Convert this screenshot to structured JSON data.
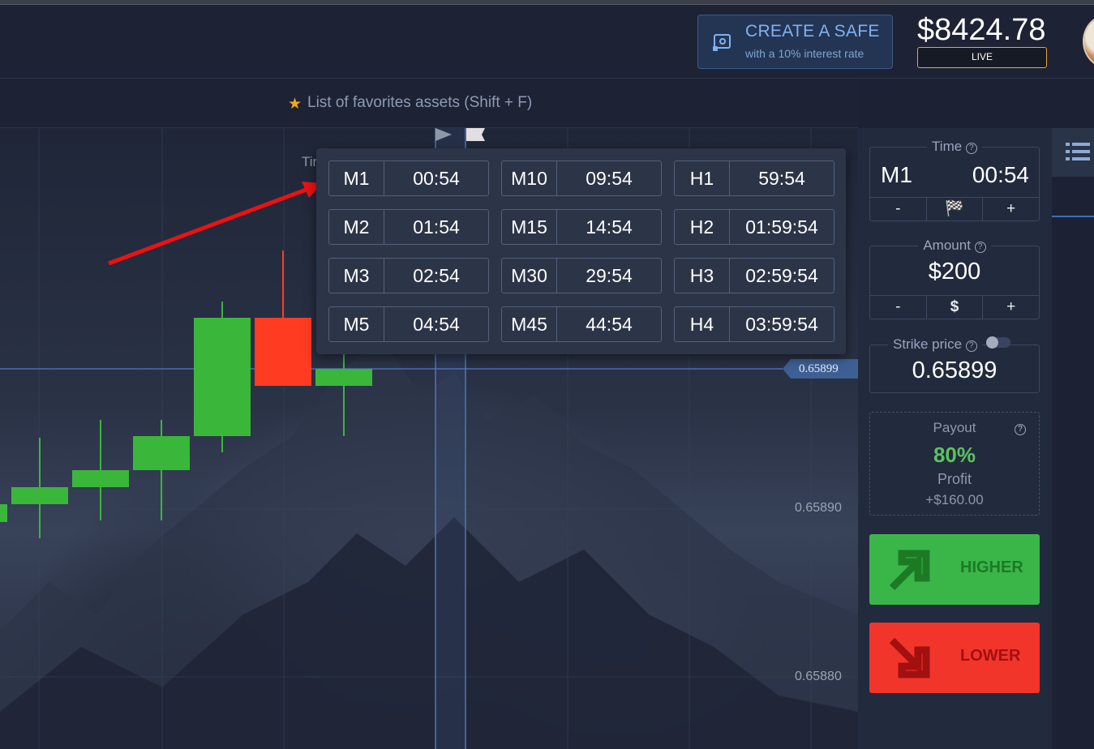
{
  "header": {
    "safe_button": {
      "title": "CREATE A SAFE",
      "subtitle": "with a 10% interest rate"
    },
    "balance": "$8424.78",
    "account_mode": "LIVE"
  },
  "favorites_bar": {
    "label": "List of favorites assets (Shift + F)"
  },
  "chart": {
    "price_levels": [
      "0.65899",
      "0.65890",
      "0.65880"
    ],
    "current_price_tag": "0.65899",
    "partial_label": "Tir"
  },
  "expiration_dropdown": {
    "options": [
      [
        {
          "code": "M1",
          "time": "00:54"
        },
        {
          "code": "M10",
          "time": "09:54"
        },
        {
          "code": "H1",
          "time": "59:54"
        }
      ],
      [
        {
          "code": "M2",
          "time": "01:54"
        },
        {
          "code": "M15",
          "time": "14:54"
        },
        {
          "code": "H2",
          "time": "01:59:54"
        }
      ],
      [
        {
          "code": "M3",
          "time": "02:54"
        },
        {
          "code": "M30",
          "time": "29:54"
        },
        {
          "code": "H3",
          "time": "02:59:54"
        }
      ],
      [
        {
          "code": "M5",
          "time": "04:54"
        },
        {
          "code": "M45",
          "time": "44:54"
        },
        {
          "code": "H4",
          "time": "03:59:54"
        }
      ]
    ]
  },
  "trade_panel": {
    "time": {
      "label": "Time",
      "mode": "M1",
      "value": "00:54",
      "minus": "-",
      "plus": "+"
    },
    "amount": {
      "label": "Amount",
      "value": "$200",
      "minus": "-",
      "currency": "$",
      "plus": "+"
    },
    "strike": {
      "label": "Strike price",
      "value": "0.65899"
    },
    "payout": {
      "label": "Payout",
      "percent": "80%",
      "profit_label": "Profit",
      "profit_value": "+$160.00"
    },
    "higher_label": "HIGHER",
    "lower_label": "LOWER"
  },
  "colors": {
    "accent_blue": "#7fb2ef",
    "live_border": "#e8a53a",
    "higher_green": "#3ab649",
    "lower_red": "#f2352a",
    "bull_candle": "#3ab63a",
    "bear_candle": "#ff3b22",
    "payout_green": "#5cc25c",
    "annotation_arrow": "#ee1111"
  },
  "icons": [
    "safe-icon",
    "star-icon",
    "question-icon",
    "flag-icon",
    "list-icon",
    "arrow-up-right-icon",
    "arrow-down-right-icon"
  ]
}
